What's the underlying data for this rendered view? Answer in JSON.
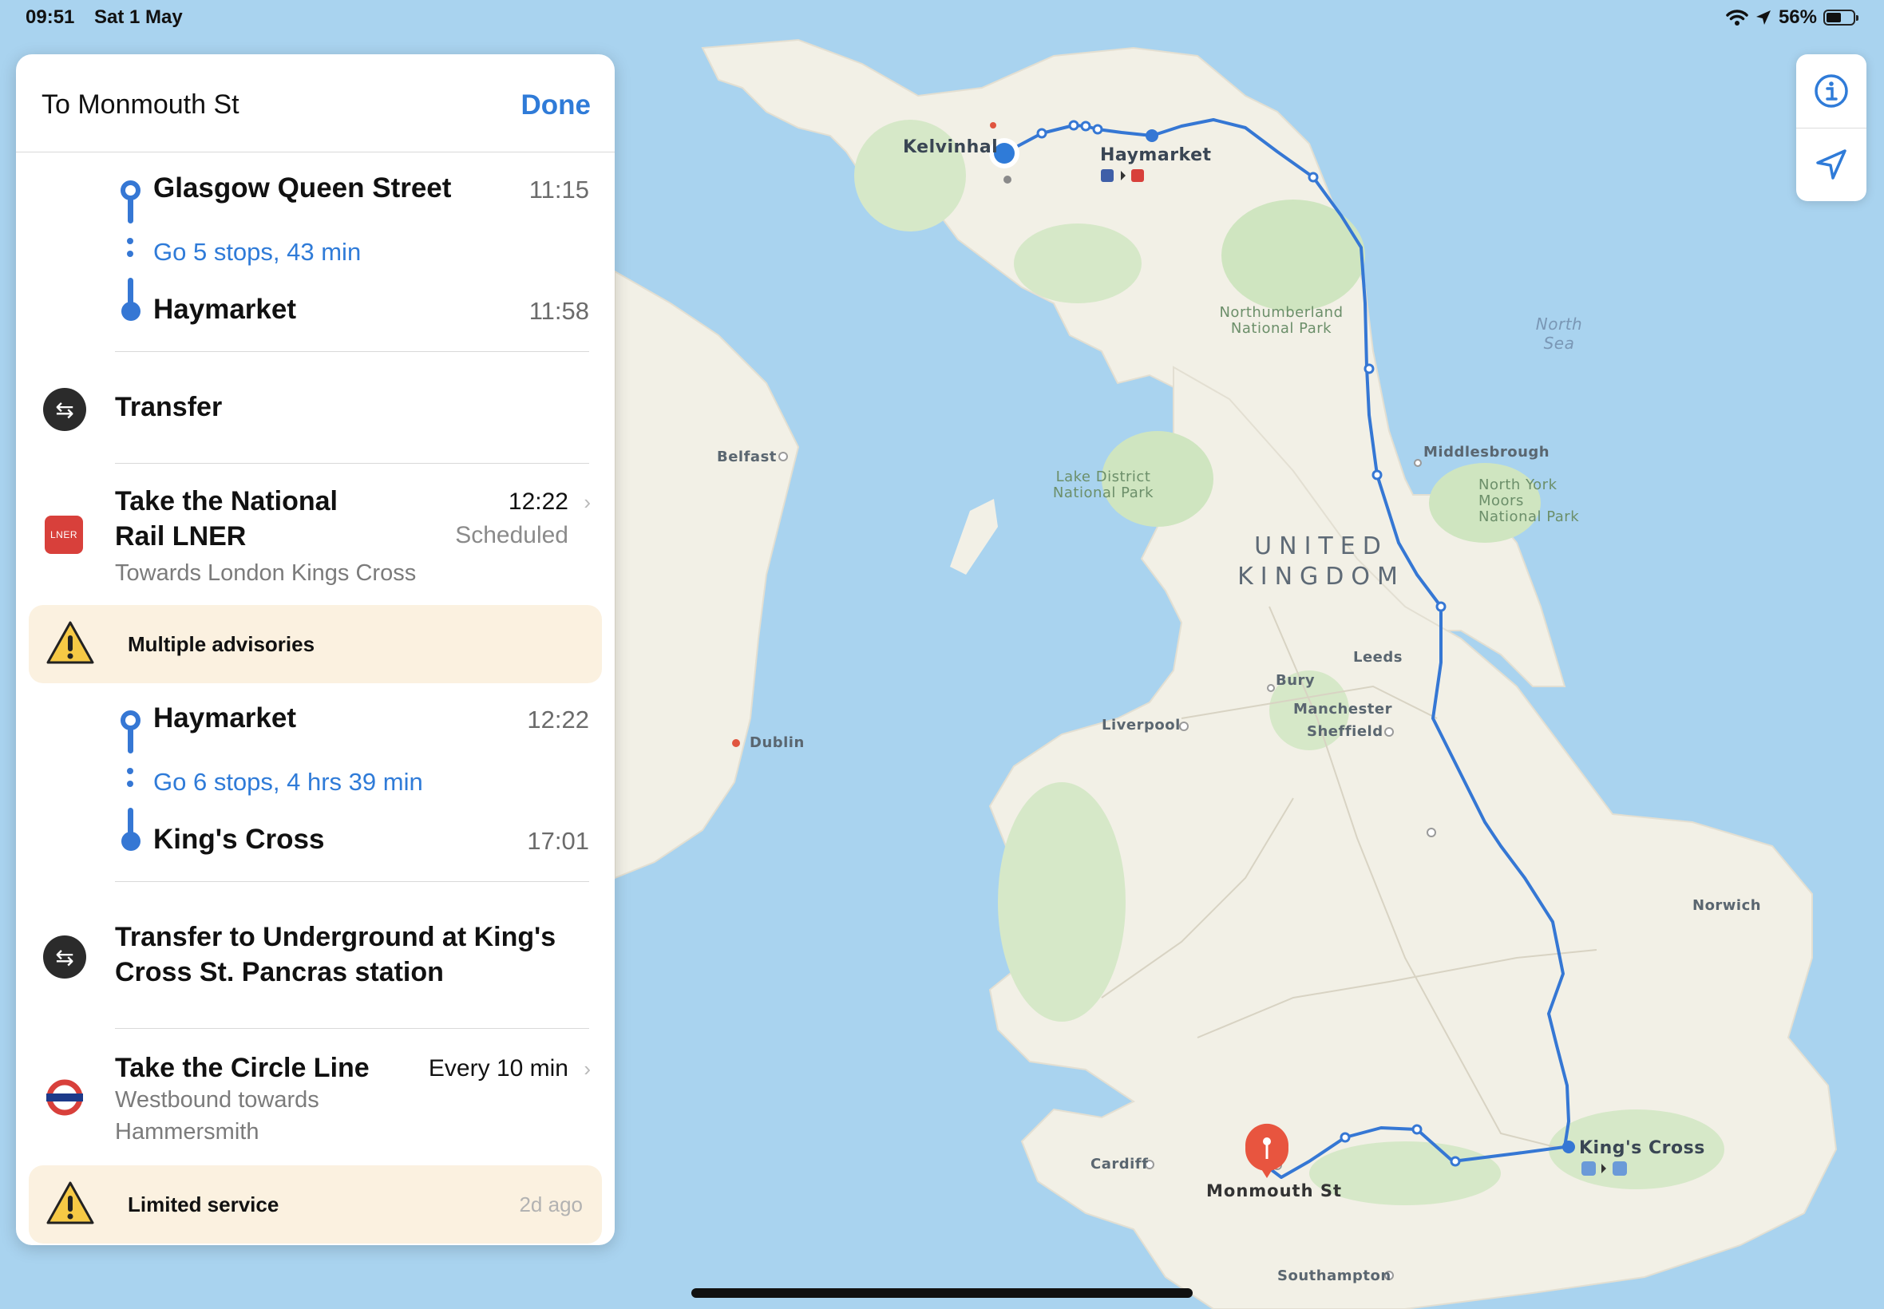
{
  "status_bar": {
    "time": "09:51",
    "date": "Sat 1 May",
    "battery": "56%",
    "battery_level": 0.56
  },
  "panel": {
    "title": "To Monmouth St",
    "done_label": "Done",
    "leg1": {
      "from": "Glasgow Queen Street",
      "from_time": "11:15",
      "stops": "Go 5 stops, 43 min",
      "to": "Haymarket",
      "to_time": "11:58"
    },
    "transfer1": {
      "label": "Transfer"
    },
    "train": {
      "title_line1": "Take the National",
      "title_line2": "Rail LNER",
      "subtitle": "Towards London Kings Cross",
      "time": "12:22",
      "status": "Scheduled",
      "badge": "LNER"
    },
    "advisory1": {
      "label": "Multiple advisories"
    },
    "leg2": {
      "from": "Haymarket",
      "from_time": "12:22",
      "stops": "Go 6 stops, 4 hrs 39 min",
      "to": "King's Cross",
      "to_time": "17:01"
    },
    "transfer2": {
      "line1": "Transfer to Underground at King's",
      "line2": "Cross St. Pancras station"
    },
    "tube": {
      "title": "Take the Circle Line",
      "frequency": "Every 10 min",
      "subtitle_line1": "Westbound towards",
      "subtitle_line2": "Hammersmith"
    },
    "advisory2": {
      "label": "Limited service",
      "time": "2d ago"
    }
  },
  "map": {
    "labels": {
      "kelvinhall": "Kelvinhal",
      "haymarket": "Haymarket",
      "north_sea_1": "North",
      "north_sea_2": "Sea",
      "northumberland_1": "Northumberland",
      "northumberland_2": "National Park",
      "belfast": "Belfast",
      "middlesbrough": "Middlesbrough",
      "lake_district_1": "Lake District",
      "lake_district_2": "National Park",
      "north_york_1": "North York",
      "north_york_2": "Moors",
      "north_york_3": "National Park",
      "uk_1": "UNITED",
      "uk_2": "KINGDOM",
      "leeds": "Leeds",
      "bury": "Bury",
      "liverpool": "Liverpool",
      "manchester": "Manchester",
      "sheffield": "Sheffield",
      "dublin": "Dublin",
      "norwich": "Norwich",
      "kings_cross": "King's Cross",
      "cardiff": "Cardiff",
      "monmouth": "Monmouth St",
      "southampton": "Southampton"
    }
  },
  "colors": {
    "accent": "#2f7bd8",
    "route": "#3577d4",
    "lner": "#d8403b",
    "land": "#f2f0e6",
    "park": "#cfe5c0",
    "water": "#a9d3ef",
    "pin": "#e8553f"
  },
  "icons": {
    "transfer": "transfer-icon",
    "warning": "warning-icon",
    "info": "info-icon",
    "location": "location-arrow-icon"
  }
}
